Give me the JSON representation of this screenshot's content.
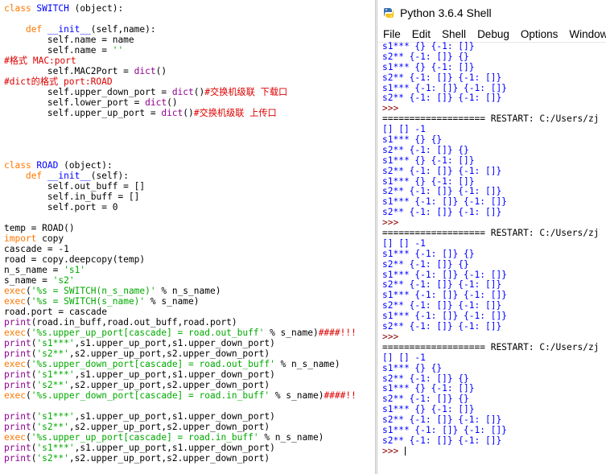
{
  "editor": {
    "lines": [
      [
        [
          "kw",
          "class "
        ],
        [
          "def",
          "SWITCH"
        ],
        [
          "plain",
          " (object):"
        ]
      ],
      [],
      [
        [
          "plain",
          "    "
        ],
        [
          "kw",
          "def "
        ],
        [
          "def",
          "__init__"
        ],
        [
          "plain",
          "(self,name):"
        ]
      ],
      [
        [
          "plain",
          "        self.name = name"
        ]
      ],
      [
        [
          "plain",
          "        self.name = "
        ],
        [
          "str",
          "''"
        ]
      ],
      [
        [
          "com",
          "#格式 MAC:port"
        ]
      ],
      [
        [
          "plain",
          "        self.MAC2Port = "
        ],
        [
          "bi",
          "dict"
        ],
        [
          "plain",
          "()"
        ]
      ],
      [
        [
          "com",
          "#dict的格式 port:ROAD"
        ]
      ],
      [
        [
          "plain",
          "        self.upper_down_port = "
        ],
        [
          "bi",
          "dict"
        ],
        [
          "plain",
          "()"
        ],
        [
          "com",
          "#交换机级联 下载口"
        ]
      ],
      [
        [
          "plain",
          "        self.lower_port = "
        ],
        [
          "bi",
          "dict"
        ],
        [
          "plain",
          "()"
        ]
      ],
      [
        [
          "plain",
          "        self.upper_up_port = "
        ],
        [
          "bi",
          "dict"
        ],
        [
          "plain",
          "()"
        ],
        [
          "com",
          "#交换机级联 上传口"
        ]
      ],
      [],
      [],
      [],
      [],
      [
        [
          "kw",
          "class "
        ],
        [
          "def",
          "ROAD"
        ],
        [
          "plain",
          " (object):"
        ]
      ],
      [
        [
          "plain",
          "    "
        ],
        [
          "kw",
          "def "
        ],
        [
          "def",
          "__init__"
        ],
        [
          "plain",
          "(self):"
        ]
      ],
      [
        [
          "plain",
          "        self.out_buff = []"
        ]
      ],
      [
        [
          "plain",
          "        self.in_buff = []"
        ]
      ],
      [
        [
          "plain",
          "        self.port = 0"
        ]
      ],
      [],
      [
        [
          "plain",
          "temp = ROAD()"
        ]
      ],
      [
        [
          "kw",
          "import"
        ],
        [
          "plain",
          " copy"
        ]
      ],
      [
        [
          "plain",
          "cascade = -1"
        ]
      ],
      [
        [
          "plain",
          "road = copy.deepcopy(temp)"
        ]
      ],
      [
        [
          "plain",
          "n_s_name = "
        ],
        [
          "str",
          "'s1'"
        ]
      ],
      [
        [
          "plain",
          "s_name = "
        ],
        [
          "str",
          "'s2'"
        ]
      ],
      [
        [
          "kw",
          "exec"
        ],
        [
          "plain",
          "("
        ],
        [
          "str",
          "'%s = SWITCH(n_s_name)'"
        ],
        [
          "plain",
          " % n_s_name)"
        ]
      ],
      [
        [
          "kw",
          "exec"
        ],
        [
          "plain",
          "("
        ],
        [
          "str",
          "'%s = SWITCH(s_name)'"
        ],
        [
          "plain",
          " % s_name)"
        ]
      ],
      [
        [
          "plain",
          "road.port = cascade"
        ]
      ],
      [
        [
          "bi",
          "print"
        ],
        [
          "plain",
          "(road.in_buff,road.out_buff,road.port)"
        ]
      ],
      [
        [
          "kw",
          "exec"
        ],
        [
          "plain",
          "("
        ],
        [
          "str",
          "'%s.upper_up_port[cascade] = road.out_buff'"
        ],
        [
          "plain",
          " % s_name)"
        ],
        [
          "com",
          "####!!!"
        ]
      ],
      [
        [
          "bi",
          "print"
        ],
        [
          "plain",
          "("
        ],
        [
          "str",
          "'s1***'"
        ],
        [
          "plain",
          ",s1.upper_up_port,s1.upper_down_port)"
        ]
      ],
      [
        [
          "bi",
          "print"
        ],
        [
          "plain",
          "("
        ],
        [
          "str",
          "'s2**'"
        ],
        [
          "plain",
          ",s2.upper_up_port,s2.upper_down_port)"
        ]
      ],
      [
        [
          "kw",
          "exec"
        ],
        [
          "plain",
          "("
        ],
        [
          "str",
          "'%s.upper_down_port[cascade] = road.out_buff'"
        ],
        [
          "plain",
          " % n_s_name)"
        ]
      ],
      [
        [
          "bi",
          "print"
        ],
        [
          "plain",
          "("
        ],
        [
          "str",
          "'s1***'"
        ],
        [
          "plain",
          ",s1.upper_up_port,s1.upper_down_port)"
        ]
      ],
      [
        [
          "bi",
          "print"
        ],
        [
          "plain",
          "("
        ],
        [
          "str",
          "'s2**'"
        ],
        [
          "plain",
          ",s2.upper_up_port,s2.upper_down_port)"
        ]
      ],
      [
        [
          "kw",
          "exec"
        ],
        [
          "plain",
          "("
        ],
        [
          "str",
          "'%s.upper_down_port[cascade] = road.in_buff'"
        ],
        [
          "plain",
          " % s_name)"
        ],
        [
          "com",
          "####!!"
        ]
      ],
      [],
      [
        [
          "bi",
          "print"
        ],
        [
          "plain",
          "("
        ],
        [
          "str",
          "'s1***'"
        ],
        [
          "plain",
          ",s1.upper_up_port,s1.upper_down_port)"
        ]
      ],
      [
        [
          "bi",
          "print"
        ],
        [
          "plain",
          "("
        ],
        [
          "str",
          "'s2**'"
        ],
        [
          "plain",
          ",s2.upper_up_port,s2.upper_down_port)"
        ]
      ],
      [
        [
          "kw",
          "exec"
        ],
        [
          "plain",
          "("
        ],
        [
          "str",
          "'%s.upper_up_port[cascade] = road.in_buff'"
        ],
        [
          "plain",
          " % n_s_name)"
        ]
      ],
      [
        [
          "bi",
          "print"
        ],
        [
          "plain",
          "("
        ],
        [
          "str",
          "'s1***'"
        ],
        [
          "plain",
          ",s1.upper_up_port,s1.upper_down_port)"
        ]
      ],
      [
        [
          "bi",
          "print"
        ],
        [
          "plain",
          "("
        ],
        [
          "str",
          "'s2**'"
        ],
        [
          "plain",
          ",s2.upper_up_port,s2.upper_down_port)"
        ]
      ]
    ]
  },
  "shell": {
    "title": "Python 3.6.4 Shell",
    "icon": "python-icon",
    "menu": [
      "File",
      "Edit",
      "Shell",
      "Debug",
      "Options",
      "Window"
    ],
    "lines": [
      [
        "out",
        "s1*** {} {-1: []}"
      ],
      [
        "out",
        "s2** {-1: []} {}"
      ],
      [
        "out",
        "s1*** {} {-1: []}"
      ],
      [
        "out",
        "s2** {-1: []} {-1: []}"
      ],
      [
        "out",
        "s1*** {-1: []} {-1: []}"
      ],
      [
        "out",
        "s2** {-1: []} {-1: []}"
      ],
      [
        "prompt",
        ">>>"
      ],
      [
        "sep",
        "=================== RESTART: C:/Users/zj"
      ],
      [
        "out",
        "[] [] -1"
      ],
      [
        "out",
        "s1*** {} {}"
      ],
      [
        "out",
        "s2** {-1: []} {}"
      ],
      [
        "out",
        "s1*** {} {-1: []}"
      ],
      [
        "out",
        "s2** {-1: []} {-1: []}"
      ],
      [
        "out",
        "s1*** {} {-1: []}"
      ],
      [
        "out",
        "s2** {-1: []} {-1: []}"
      ],
      [
        "out",
        "s1*** {-1: []} {-1: []}"
      ],
      [
        "out",
        "s2** {-1: []} {-1: []}"
      ],
      [
        "prompt",
        ">>>"
      ],
      [
        "sep",
        "=================== RESTART: C:/Users/zj"
      ],
      [
        "out",
        "[] [] -1"
      ],
      [
        "out",
        "s1*** {-1: []} {}"
      ],
      [
        "out",
        "s2** {-1: []} {}"
      ],
      [
        "out",
        "s1*** {-1: []} {-1: []}"
      ],
      [
        "out",
        "s2** {-1: []} {-1: []}"
      ],
      [
        "out",
        "s1*** {-1: []} {-1: []}"
      ],
      [
        "out",
        "s2** {-1: []} {-1: []}"
      ],
      [
        "out",
        "s1*** {-1: []} {-1: []}"
      ],
      [
        "out",
        "s2** {-1: []} {-1: []}"
      ],
      [
        "prompt",
        ">>>"
      ],
      [
        "sep",
        "=================== RESTART: C:/Users/zj"
      ],
      [
        "out",
        "[] [] -1"
      ],
      [
        "out",
        "s1*** {} {}"
      ],
      [
        "out",
        "s2** {-1: []} {}"
      ],
      [
        "out",
        "s1*** {} {-1: []}"
      ],
      [
        "out",
        "s2** {-1: []} {}"
      ],
      [
        "out",
        "s1*** {} {-1: []}"
      ],
      [
        "out",
        "s2** {-1: []} {-1: []}"
      ],
      [
        "out",
        "s1*** {-1: []} {-1: []}"
      ],
      [
        "out",
        "s2** {-1: []} {-1: []}"
      ],
      [
        "prompt",
        ">>> "
      ]
    ]
  }
}
